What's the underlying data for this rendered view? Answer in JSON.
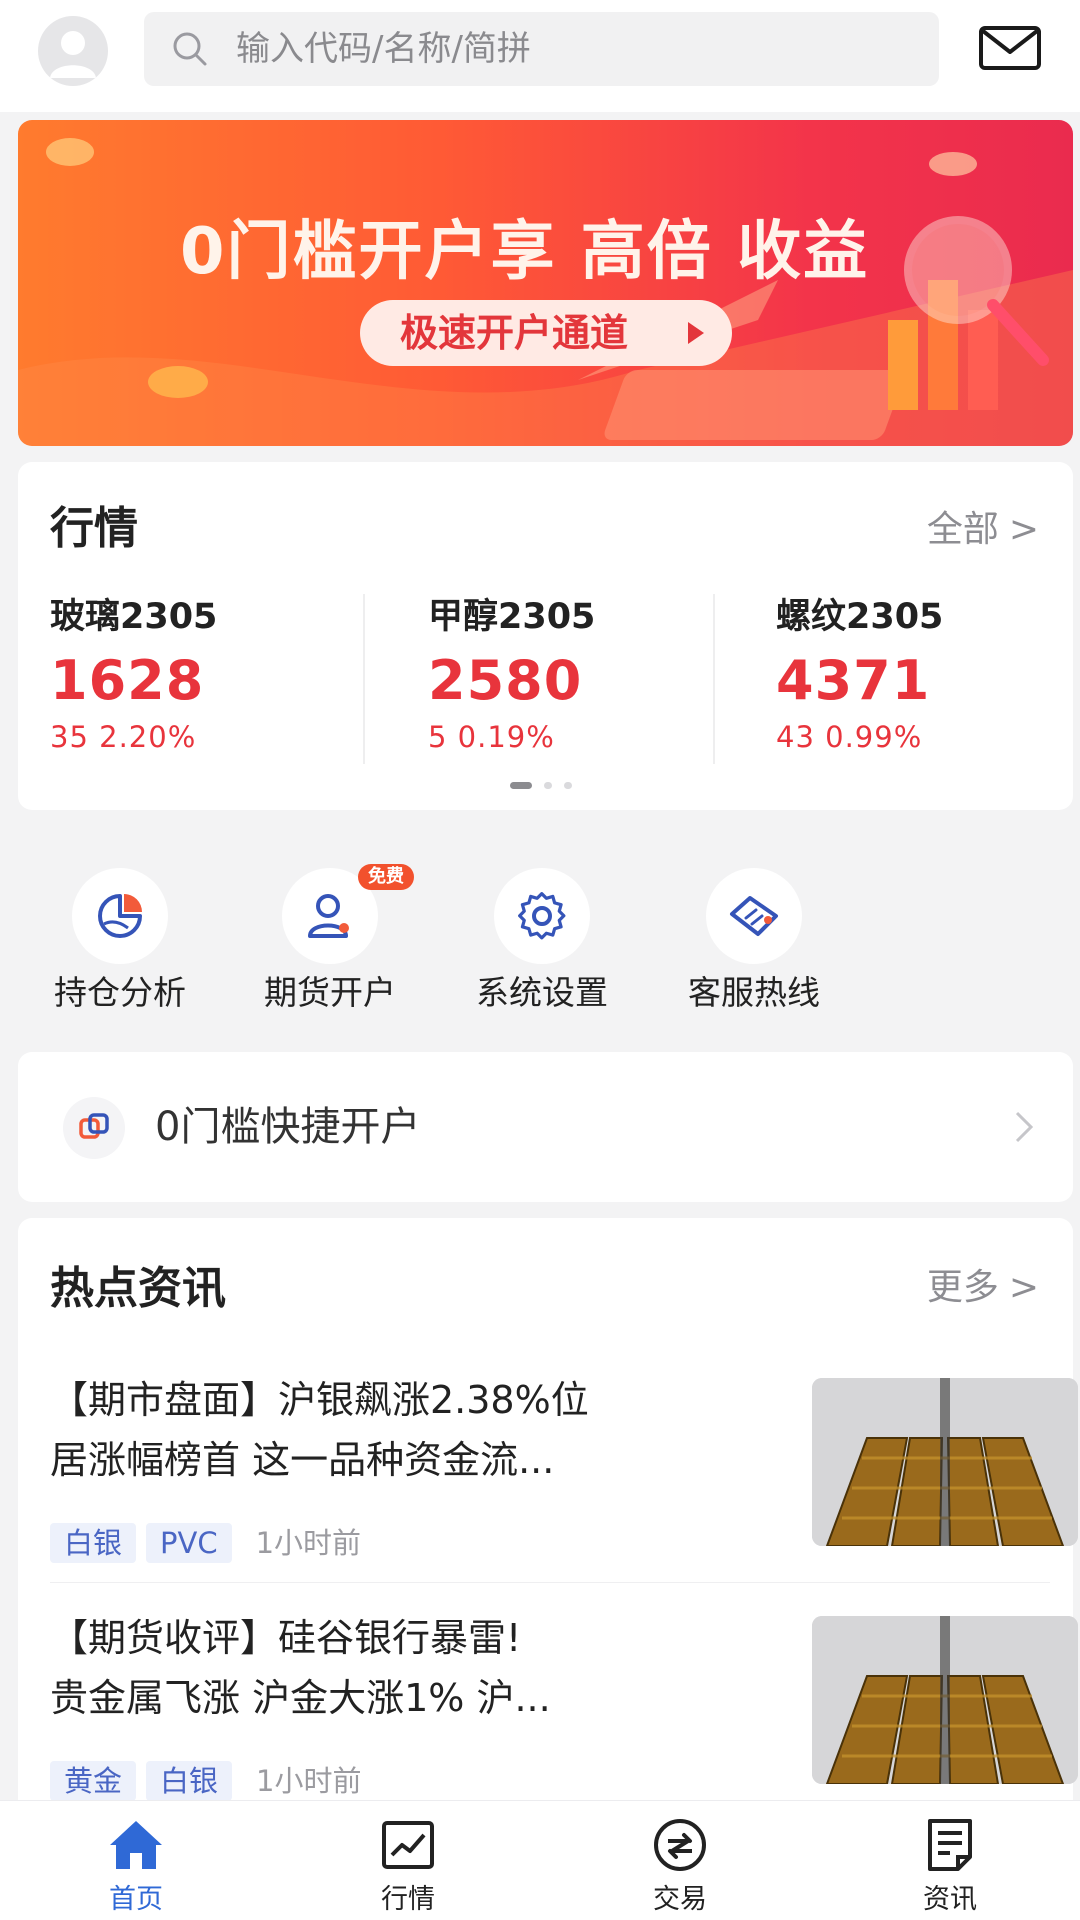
{
  "header": {
    "search_placeholder": "输入代码/名称/简拼"
  },
  "banner": {
    "headline": "0门槛开户享 高倍 收益",
    "cta": "极速开户通道"
  },
  "market": {
    "title": "行情",
    "more": "全部",
    "quotes": [
      {
        "name": "玻璃2305",
        "price": "1628",
        "change": "35 2.20%"
      },
      {
        "name": "甲醇2305",
        "price": "2580",
        "change": "5 0.19%"
      },
      {
        "name": "螺纹2305",
        "price": "4371",
        "change": "43 0.99%"
      }
    ],
    "price_color": "#e8343c"
  },
  "menu": {
    "items": [
      {
        "label": "持仓分析",
        "icon": "pie-chart-icon"
      },
      {
        "label": "期货开户",
        "icon": "user-add-icon",
        "badge": "免费"
      },
      {
        "label": "系统设置",
        "icon": "gear-icon"
      },
      {
        "label": "客服热线",
        "icon": "handshake-icon"
      }
    ]
  },
  "quick_open": {
    "label": "0门槛快捷开户"
  },
  "news": {
    "title": "热点资讯",
    "more": "更多",
    "items": [
      {
        "line1": "【期市盘面】沪银飙涨2.38%位",
        "line2": "居涨幅榜首 这一品种资金流...",
        "tags": [
          "白银",
          "PVC"
        ],
        "time": "1小时前"
      },
      {
        "line1": "【期货收评】硅谷银行暴雷!",
        "line2": "贵金属飞涨 沪金大涨1% 沪...",
        "tags": [
          "黄金",
          "白银"
        ],
        "time": "1小时前"
      }
    ]
  },
  "tabbar": {
    "tabs": [
      {
        "label": "首页",
        "icon": "home-icon",
        "active": true
      },
      {
        "label": "行情",
        "icon": "chart-icon"
      },
      {
        "label": "交易",
        "icon": "trade-icon"
      },
      {
        "label": "资讯",
        "icon": "news-icon"
      }
    ],
    "active_color": "#2f69d6"
  }
}
